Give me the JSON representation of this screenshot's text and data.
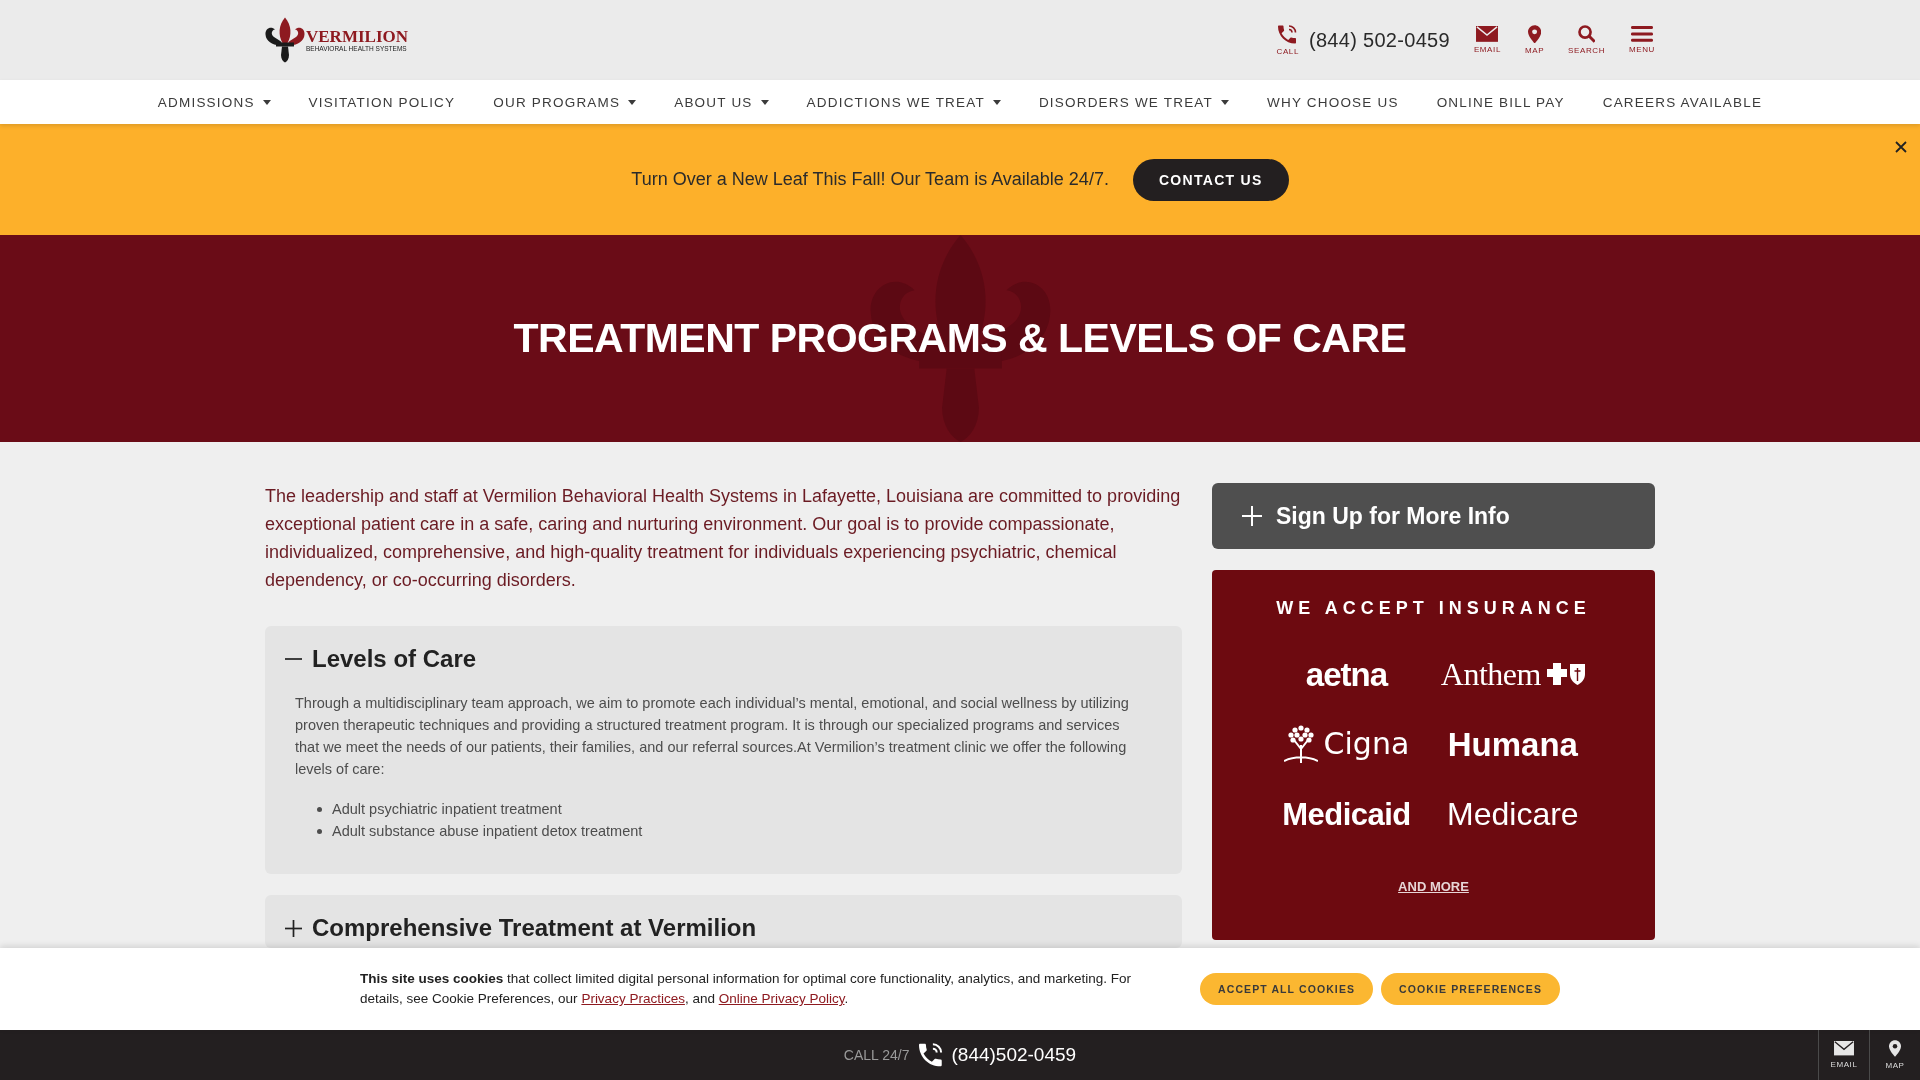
{
  "header": {
    "logo": {
      "name": "VERMILION",
      "tagline": "BEHAVIORAL HEALTH SYSTEMS"
    },
    "call": {
      "label": "CALL",
      "phone": "(844) 502-0459"
    },
    "actions": [
      {
        "kind": "email",
        "label": "EMAIL"
      },
      {
        "kind": "map",
        "label": "MAP"
      },
      {
        "kind": "search",
        "label": "SEARCH"
      },
      {
        "kind": "menu",
        "label": "MENU"
      }
    ]
  },
  "nav": {
    "items": [
      {
        "label": "ADMISSIONS",
        "dropdown": true
      },
      {
        "label": "VISITATION POLICY",
        "dropdown": false
      },
      {
        "label": "OUR PROGRAMS",
        "dropdown": true
      },
      {
        "label": "ABOUT US",
        "dropdown": true
      },
      {
        "label": "ADDICTIONS WE TREAT",
        "dropdown": true
      },
      {
        "label": "DISORDERS WE TREAT",
        "dropdown": true
      },
      {
        "label": "WHY CHOOSE US",
        "dropdown": false
      },
      {
        "label": "ONLINE BILL PAY",
        "dropdown": false
      },
      {
        "label": "CAREERS AVAILABLE",
        "dropdown": false
      }
    ]
  },
  "banner": {
    "text": "Turn Over a New Leaf This Fall! Our Team is Available 24/7.",
    "button": "CONTACT US"
  },
  "hero": {
    "title": "TREATMENT PROGRAMS & LEVELS OF CARE"
  },
  "content": {
    "intro": "The leadership and staff at Vermilion Behavioral Health Systems in Lafayette, Louisiana are committed to providing exceptional patient care in a safe, caring and nurturing environment. Our goal is to provide compassionate, individualized, comprehensive, and high-quality treatment for individuals experiencing psychiatric, chemical dependency, or co-occurring disorders.",
    "accordions": [
      {
        "title": "Levels of Care",
        "expanded": true,
        "text": "Through a multidisciplinary team approach, we aim to promote each individual’s mental, emotional, and social wellness by utilizing proven therapeutic techniques and providing a structured treatment program. It is through our specialized programs and services that we meet the needs of our patients, their families, and our referral sources.At Vermilion’s treatment clinic we offer the following levels of care:",
        "items": [
          "Adult psychiatric inpatient treatment",
          "Adult substance abuse inpatient detox treatment"
        ]
      },
      {
        "title": "Comprehensive Treatment at Vermilion",
        "expanded": false
      }
    ]
  },
  "sidebar": {
    "signup": {
      "title": "Sign Up for More Info",
      "expanded": false
    },
    "insurance": {
      "title": "WE ACCEPT INSURANCE",
      "insurers": [
        {
          "kind": "aetna",
          "name": "aetna"
        },
        {
          "kind": "anthem",
          "name": "Anthem"
        },
        {
          "kind": "cigna",
          "name": "Cigna"
        },
        {
          "kind": "humana",
          "name": "Humana"
        },
        {
          "kind": "medicaid",
          "name": "Medicaid"
        },
        {
          "kind": "medicare",
          "name": "Medicare"
        }
      ],
      "link": "AND MORE"
    }
  },
  "cookie_notice": {
    "parts": [
      {
        "kind": "text",
        "text": "**This site uses cookies** that collect limited digital personal information for optimal core functionality, analytics, and marketing. For details, see Cookie Preferences, our "
      },
      {
        "kind": "link",
        "text": "Privacy Practices"
      },
      {
        "kind": "text",
        "text": ", and "
      },
      {
        "kind": "link",
        "text": "Online Privacy Policy"
      },
      {
        "kind": "text",
        "text": "."
      }
    ],
    "buttons": [
      "ACCEPT ALL COOKIES",
      "COOKIE PREFERENCES"
    ]
  },
  "call_bar": {
    "label": "CALL 24/7",
    "phone": "(844)502-0459",
    "actions": [
      {
        "kind": "email",
        "label": "EMAIL"
      },
      {
        "kind": "map",
        "label": "MAP"
      }
    ]
  }
}
